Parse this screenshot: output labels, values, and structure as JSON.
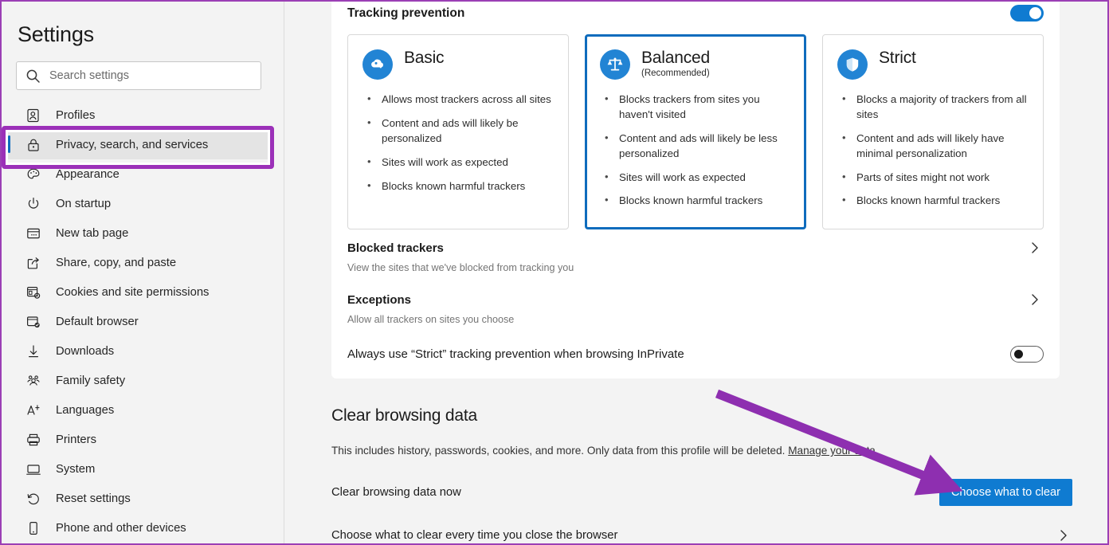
{
  "sidebar": {
    "title": "Settings",
    "search": {
      "placeholder": "Search settings",
      "value": "",
      "icon": "search-icon"
    },
    "items": [
      {
        "label": "Profiles",
        "icon": "profile-icon",
        "selected": false
      },
      {
        "label": "Privacy, search, and services",
        "icon": "lock-icon",
        "selected": true
      },
      {
        "label": "Appearance",
        "icon": "palette-icon",
        "selected": false
      },
      {
        "label": "On startup",
        "icon": "power-icon",
        "selected": false
      },
      {
        "label": "New tab page",
        "icon": "new-tab-icon",
        "selected": false
      },
      {
        "label": "Share, copy, and paste",
        "icon": "share-icon",
        "selected": false
      },
      {
        "label": "Cookies and site permissions",
        "icon": "cookies-icon",
        "selected": false
      },
      {
        "label": "Default browser",
        "icon": "default-browser-icon",
        "selected": false
      },
      {
        "label": "Downloads",
        "icon": "download-icon",
        "selected": false
      },
      {
        "label": "Family safety",
        "icon": "family-icon",
        "selected": false
      },
      {
        "label": "Languages",
        "icon": "languages-icon",
        "selected": false
      },
      {
        "label": "Printers",
        "icon": "printer-icon",
        "selected": false
      },
      {
        "label": "System",
        "icon": "system-icon",
        "selected": false
      },
      {
        "label": "Reset settings",
        "icon": "reset-icon",
        "selected": false
      },
      {
        "label": "Phone and other devices",
        "icon": "phone-icon",
        "selected": false
      }
    ]
  },
  "tracking_prevention": {
    "heading": "Tracking prevention",
    "toggle_state": "on",
    "cards": [
      {
        "title": "Basic",
        "subtitle": "",
        "icon": "cloud-tracker-icon",
        "selected": false,
        "bullets": [
          "Allows most trackers across all sites",
          "Content and ads will likely be personalized",
          "Sites will work as expected",
          "Blocks known harmful trackers"
        ]
      },
      {
        "title": "Balanced",
        "subtitle": "(Recommended)",
        "icon": "scales-icon",
        "selected": true,
        "bullets": [
          "Blocks trackers from sites you haven't visited",
          "Content and ads will likely be less personalized",
          "Sites will work as expected",
          "Blocks known harmful trackers"
        ]
      },
      {
        "title": "Strict",
        "subtitle": "",
        "icon": "shield-icon",
        "selected": false,
        "bullets": [
          "Blocks a majority of trackers from all sites",
          "Content and ads will likely have minimal personalization",
          "Parts of sites might not work",
          "Blocks known harmful trackers"
        ]
      }
    ],
    "rows": [
      {
        "title": "Blocked trackers",
        "desc": "View the sites that we've blocked from tracking you",
        "action": "chevron-right-icon"
      },
      {
        "title": "Exceptions",
        "desc": "Allow all trackers on sites you choose",
        "action": "chevron-right-icon"
      }
    ],
    "inprivate_row": {
      "title": "Always use “Strict” tracking prevention when browsing InPrivate",
      "toggle_state": "off"
    }
  },
  "clear_browsing_data": {
    "heading": "Clear browsing data",
    "description_prefix": "This includes history, passwords, cookies, and more. Only data from this profile will be deleted. ",
    "description_link": "Manage your data",
    "now_row": {
      "label": "Clear browsing data now",
      "button": "Choose what to clear"
    },
    "every_time_row": {
      "label": "Choose what to clear every time you close the browser",
      "action": "chevron-right-icon"
    }
  },
  "annotations": {
    "highlight_color": "#9b30b8",
    "arrow_color": "#8e2fb0",
    "accent_color": "#0f7bd1",
    "selected_card_border": "#0f6cbd"
  }
}
